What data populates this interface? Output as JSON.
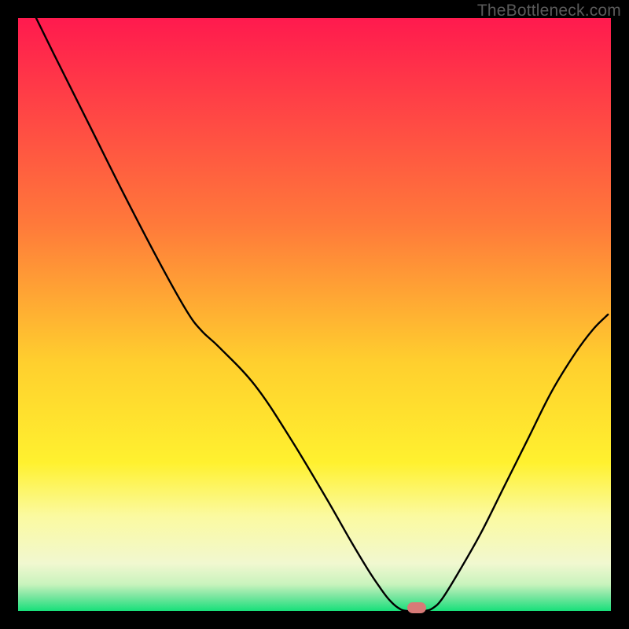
{
  "watermark": "TheBottleneck.com",
  "chart_data": {
    "type": "line",
    "title": "",
    "xlabel": "",
    "ylabel": "",
    "xlim": [
      0,
      100
    ],
    "ylim": [
      0,
      100
    ],
    "gradient_stops": [
      {
        "offset": 0,
        "color": "#ff1a4e"
      },
      {
        "offset": 35,
        "color": "#ff7a3a"
      },
      {
        "offset": 58,
        "color": "#ffcf2e"
      },
      {
        "offset": 75,
        "color": "#fff12f"
      },
      {
        "offset": 84,
        "color": "#fbfaa0"
      },
      {
        "offset": 92,
        "color": "#f1f8d0"
      },
      {
        "offset": 95.5,
        "color": "#c9f3bd"
      },
      {
        "offset": 97.5,
        "color": "#7de6a1"
      },
      {
        "offset": 100,
        "color": "#18e07a"
      }
    ],
    "curve_points": [
      {
        "x": 3.05,
        "y": 100.0
      },
      {
        "x": 6,
        "y": 94
      },
      {
        "x": 12,
        "y": 82
      },
      {
        "x": 18,
        "y": 70
      },
      {
        "x": 24,
        "y": 58.5
      },
      {
        "x": 28.5,
        "y": 50.5
      },
      {
        "x": 31,
        "y": 47.2
      },
      {
        "x": 34,
        "y": 44.4
      },
      {
        "x": 40,
        "y": 38
      },
      {
        "x": 46,
        "y": 29
      },
      {
        "x": 52,
        "y": 19
      },
      {
        "x": 56,
        "y": 12
      },
      {
        "x": 59,
        "y": 7
      },
      {
        "x": 61,
        "y": 4
      },
      {
        "x": 62.5,
        "y": 2
      },
      {
        "x": 64,
        "y": 0.6
      },
      {
        "x": 65.5,
        "y": 0.0
      },
      {
        "x": 68.5,
        "y": 0.0
      },
      {
        "x": 70,
        "y": 0.5
      },
      {
        "x": 71.5,
        "y": 2
      },
      {
        "x": 74,
        "y": 6
      },
      {
        "x": 78,
        "y": 13
      },
      {
        "x": 82,
        "y": 21
      },
      {
        "x": 86,
        "y": 29
      },
      {
        "x": 90,
        "y": 37
      },
      {
        "x": 94,
        "y": 43.5
      },
      {
        "x": 97,
        "y": 47.5
      },
      {
        "x": 99.5,
        "y": 50
      }
    ],
    "marker": {
      "x": 67.2,
      "y": 0.5
    }
  }
}
